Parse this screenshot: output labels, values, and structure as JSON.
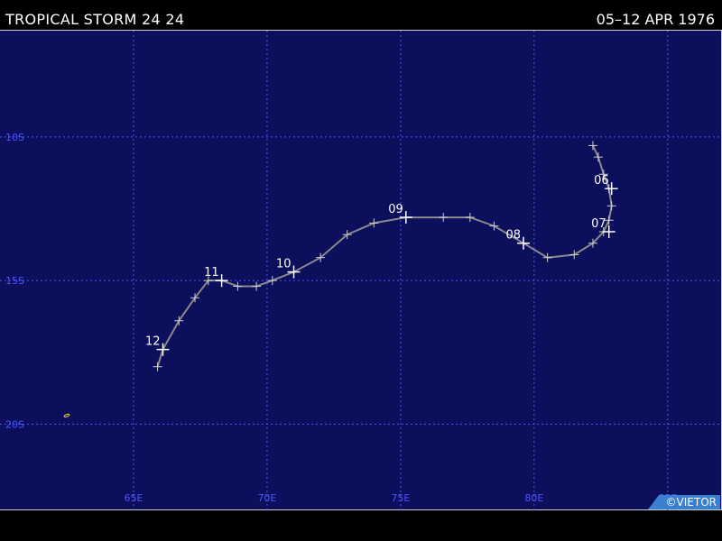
{
  "header": {
    "title": "TROPICAL STORM 24 24",
    "dates": "05–12 APR 1976"
  },
  "map": {
    "background_color": "#0b0f5c",
    "grid_color": "#4a55ff",
    "track_color": "#8a8a8a",
    "lon_range": [
      60,
      87
    ],
    "lat_range": [
      -23,
      -6.3
    ],
    "lon_ticks": [
      {
        "value": 65,
        "label": "65E"
      },
      {
        "value": 70,
        "label": "70E"
      },
      {
        "value": 75,
        "label": "75E"
      },
      {
        "value": 80,
        "label": "80E"
      },
      {
        "value": 85,
        "label": "85E"
      }
    ],
    "lat_ticks": [
      {
        "value": -10,
        "label": "10S"
      },
      {
        "value": -15,
        "label": "15S"
      },
      {
        "value": -20,
        "label": "20S"
      }
    ],
    "track": [
      [
        82.2,
        -10.3
      ],
      [
        82.4,
        -10.7
      ],
      [
        82.6,
        -11.3
      ],
      [
        82.8,
        -11.8
      ],
      [
        82.9,
        -12.4
      ],
      [
        82.8,
        -12.9
      ],
      [
        82.6,
        -13.3
      ],
      [
        82.2,
        -13.7
      ],
      [
        81.5,
        -14.1
      ],
      [
        80.5,
        -14.2
      ],
      [
        79.6,
        -13.7
      ],
      [
        78.5,
        -13.1
      ],
      [
        77.6,
        -12.8
      ],
      [
        76.6,
        -12.8
      ],
      [
        75.2,
        -12.8
      ],
      [
        74.0,
        -13.0
      ],
      [
        73.0,
        -13.4
      ],
      [
        72.0,
        -14.2
      ],
      [
        71.0,
        -14.7
      ],
      [
        70.2,
        -15.0
      ],
      [
        69.6,
        -15.2
      ],
      [
        68.9,
        -15.2
      ],
      [
        68.3,
        -15.0
      ],
      [
        67.8,
        -15.0
      ],
      [
        67.3,
        -15.6
      ],
      [
        66.7,
        -16.4
      ],
      [
        66.1,
        -17.4
      ],
      [
        65.9,
        -18.0
      ]
    ],
    "day_labels": [
      {
        "label": "06",
        "lon": 82.9,
        "lat": -11.8
      },
      {
        "label": "07",
        "lon": 82.8,
        "lat": -13.3
      },
      {
        "label": "08",
        "lon": 79.6,
        "lat": -13.7
      },
      {
        "label": "09",
        "lon": 75.2,
        "lat": -12.8
      },
      {
        "label": "10",
        "lon": 71.0,
        "lat": -14.7
      },
      {
        "label": "11",
        "lon": 68.3,
        "lat": -15.0
      },
      {
        "label": "12",
        "lon": 66.1,
        "lat": -17.4
      }
    ],
    "island": {
      "lon": 62.5,
      "lat": -19.7,
      "color": "#e0d040"
    }
  },
  "credit": {
    "text": "©VIETOR",
    "color": "#3a7fd0"
  }
}
